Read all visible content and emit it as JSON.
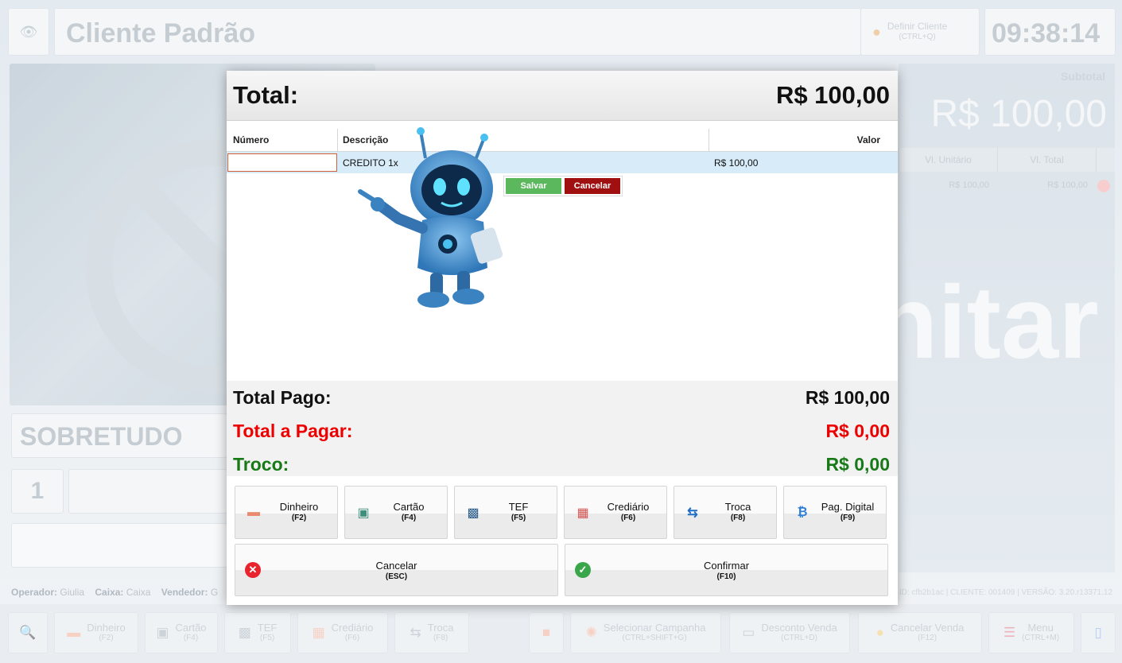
{
  "header": {
    "client_name": "Cliente Padrão",
    "define_client_label": "Definir Cliente",
    "define_client_shortcut": "(CTRL+Q)",
    "clock": "09:38:14"
  },
  "background": {
    "subtotal_label": "Subtotal",
    "subtotal_value": "R$ 100,00",
    "brand_text": "nitar",
    "grid_columns": [
      "Vl. Unitário",
      "Vl. Total"
    ],
    "grid_row": [
      "R$ 100,00",
      "R$ 100,00"
    ],
    "product_name": "SOBRETUDO",
    "quantity": "1",
    "status": {
      "operator_label": "Operador:",
      "operator": "Giulia",
      "cashier_label": "Caixa:",
      "cashier": "Caixa",
      "seller_label": "Vendedor:",
      "seller": "G"
    },
    "version": "ID: cfb2b1ac | CLIENTE: 001409 | VERSÃO: 3.20.r13371.12"
  },
  "bottom_bar": [
    {
      "label": "",
      "shortcut": "",
      "icon": "search-icon"
    },
    {
      "label": "Dinheiro",
      "shortcut": "(F2)",
      "icon": "cash-icon"
    },
    {
      "label": "Cartão",
      "shortcut": "(F4)",
      "icon": "card-icon"
    },
    {
      "label": "TEF",
      "shortcut": "(F5)",
      "icon": "tef-icon"
    },
    {
      "label": "Crediário",
      "shortcut": "(F6)",
      "icon": "calendar-icon"
    },
    {
      "label": "Troca",
      "shortcut": "(F8)",
      "icon": "swap-icon"
    },
    {
      "label": "",
      "shortcut": "",
      "icon": "gift-icon"
    },
    {
      "label": "Selecionar Campanha",
      "shortcut": "(CTRL+SHIFT+G)",
      "icon": "campaign-icon"
    },
    {
      "label": "Desconto Venda",
      "shortcut": "(CTRL+D)",
      "icon": "discount-icon"
    },
    {
      "label": "Cancelar Venda",
      "shortcut": "(F12)",
      "icon": "cancel-sale-icon"
    },
    {
      "label": "Menu",
      "shortcut": "(CTRL+M)",
      "icon": "menu-icon"
    },
    {
      "label": "",
      "shortcut": "",
      "icon": "chat-icon"
    }
  ],
  "modal": {
    "title": "Total:",
    "total": "R$ 100,00",
    "table": {
      "columns": [
        "Número",
        "Descrição",
        "Valor"
      ],
      "row": {
        "numero": "",
        "descricao": "CREDITO 1x",
        "valor": "R$ 100,00"
      }
    },
    "save_label": "Salvar",
    "cancel_small_label": "Cancelar",
    "summary": {
      "paid_label": "Total Pago:",
      "paid_value": "R$ 100,00",
      "due_label": "Total a Pagar:",
      "due_value": "R$ 0,00",
      "change_label": "Troco:",
      "change_value": "R$ 0,00"
    },
    "payment_buttons": [
      {
        "label": "Dinheiro",
        "shortcut": "(F2)"
      },
      {
        "label": "Cartão",
        "shortcut": "(F4)"
      },
      {
        "label": "TEF",
        "shortcut": "(F5)"
      },
      {
        "label": "Crediário",
        "shortcut": "(F6)"
      },
      {
        "label": "Troca",
        "shortcut": "(F8)"
      },
      {
        "label": "Pag. Digital",
        "shortcut": "(F9)"
      }
    ],
    "cancel_label": "Cancelar",
    "cancel_shortcut": "(ESC)",
    "confirm_label": "Confirmar",
    "confirm_shortcut": "(F10)"
  },
  "colors": {
    "due": "#ee0000",
    "change": "#177a17",
    "save": "#5cb85c",
    "cancel_small": "#a11010",
    "selected_row": "#d7ebf8"
  }
}
